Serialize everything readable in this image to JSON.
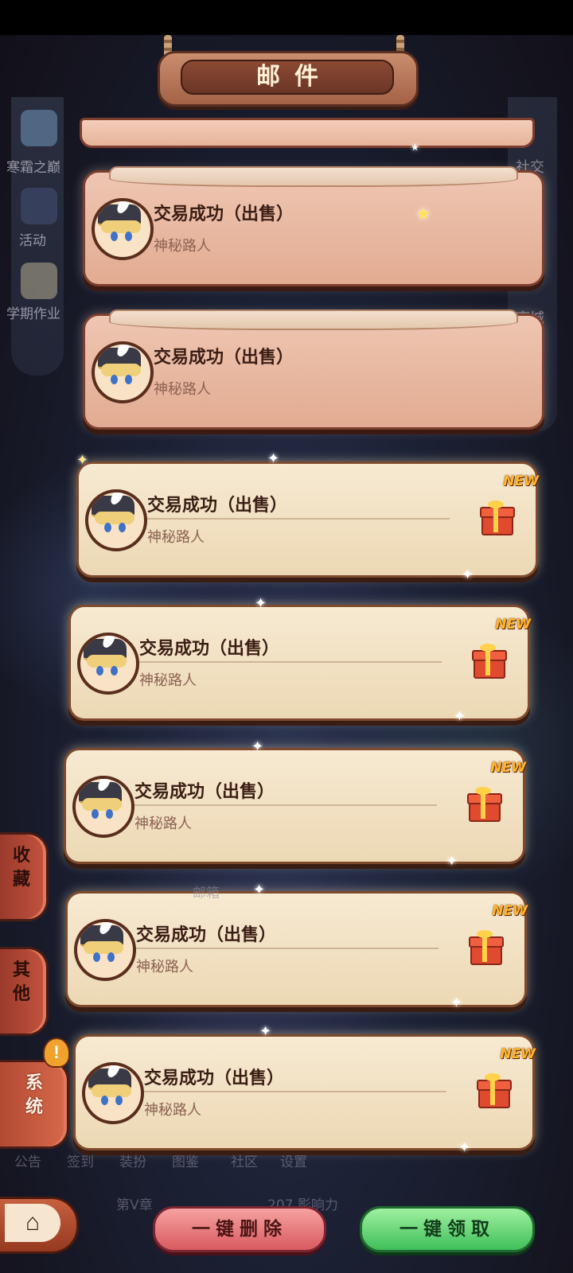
{
  "header": {
    "title": "邮件"
  },
  "left_menu": [
    {
      "label": "寒霜之巅",
      "icon": "mountain-icon"
    },
    {
      "label": "活动",
      "icon": "event-icon"
    },
    {
      "label": "学期作业",
      "icon": "homework-icon"
    }
  ],
  "right_menu": [
    "社交",
    "商城"
  ],
  "categories": [
    {
      "label": "收藏"
    },
    {
      "label": "其他"
    },
    {
      "label": "系统",
      "active": true,
      "alert": "!"
    }
  ],
  "mails": [
    {
      "title": "交易成功（出售）",
      "sender": "神秘路人",
      "read": true
    },
    {
      "title": "交易成功（出售）",
      "sender": "神秘路人",
      "read": true
    },
    {
      "title": "交易成功（出售）",
      "sender": "神秘路人",
      "read": false,
      "badge": "NEW"
    },
    {
      "title": "交易成功（出售）",
      "sender": "神秘路人",
      "read": false,
      "badge": "NEW"
    },
    {
      "title": "交易成功（出售）",
      "sender": "神秘路人",
      "read": false,
      "badge": "NEW"
    },
    {
      "title": "交易成功（出售）",
      "sender": "神秘路人",
      "read": false,
      "badge": "NEW"
    },
    {
      "title": "交易成功（出售）",
      "sender": "神秘路人",
      "read": false,
      "badge": "NEW"
    }
  ],
  "background_labels": {
    "mailbox": "邮箱",
    "chapter": "第V章",
    "influence": "207 影响力",
    "bottom_nav": [
      "公告",
      "签到",
      "装扮",
      "图鉴",
      "社区",
      "设置"
    ]
  },
  "actions": {
    "home_icon": "home-icon",
    "delete_all": "一键删除",
    "claim_all": "一键领取"
  },
  "colors": {
    "read_card": "#e8b9a3",
    "unread_card": "#f3e4c8",
    "new_badge": "#ffb52e",
    "delete_button": "#e46a6e",
    "claim_button": "#57cf6a"
  }
}
